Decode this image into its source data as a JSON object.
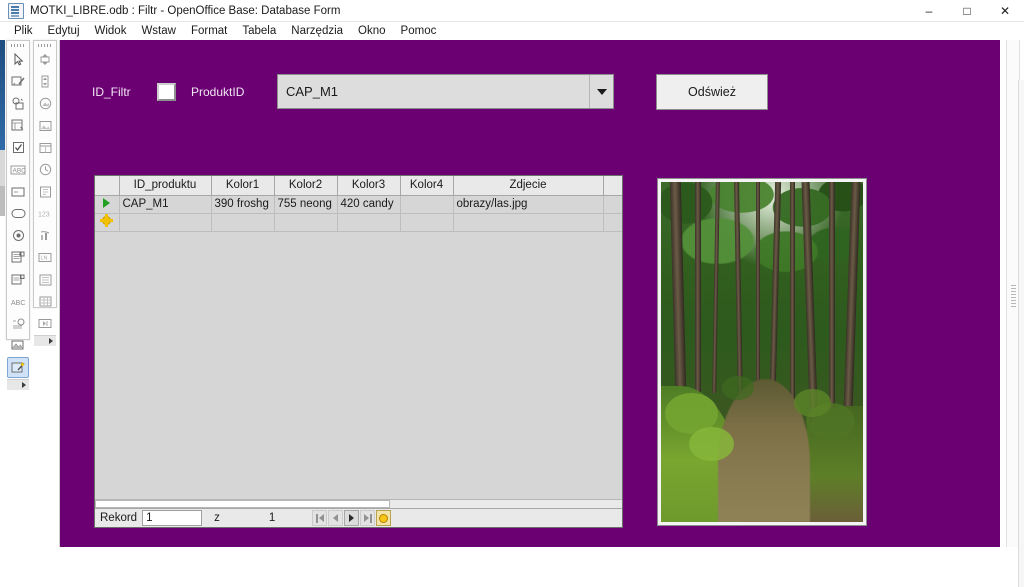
{
  "window": {
    "title": "MOTKI_LIBRE.odb : Filtr - OpenOffice Base: Database Form",
    "icon": "database-form-icon",
    "minimize_label": "–",
    "maximize_label": "□",
    "close_label": "✕"
  },
  "menubar": {
    "items": [
      {
        "label": "Plik"
      },
      {
        "label": "Edytuj"
      },
      {
        "label": "Widok"
      },
      {
        "label": "Wstaw"
      },
      {
        "label": "Format"
      },
      {
        "label": "Tabela"
      },
      {
        "label": "Narzędzia"
      },
      {
        "label": "Okno"
      },
      {
        "label": "Pomoc"
      }
    ]
  },
  "toolbars": {
    "form_controls": {
      "name": "Form Controls",
      "items": [
        {
          "icon": "select-arrow-icon",
          "selected": false
        },
        {
          "icon": "design-mode-icon",
          "selected": false
        },
        {
          "icon": "control-wizards-icon",
          "selected": false
        },
        {
          "icon": "form-properties-icon",
          "selected": false
        },
        {
          "icon": "check-box-icon",
          "selected": false
        },
        {
          "icon": "label-field-icon",
          "selected": false
        },
        {
          "icon": "text-box-icon",
          "selected": false
        },
        {
          "icon": "push-button-icon",
          "selected": false
        },
        {
          "icon": "option-button-icon",
          "selected": false
        },
        {
          "icon": "list-box-icon",
          "selected": false
        },
        {
          "icon": "combo-box-icon",
          "selected": false
        },
        {
          "icon": "formatted-field-icon",
          "selected": false
        },
        {
          "icon": "group-box-icon",
          "selected": false
        },
        {
          "icon": "image-control-icon",
          "selected": false
        },
        {
          "icon": "wizards-on-off-icon",
          "selected": true
        }
      ]
    },
    "more_controls": {
      "name": "More Controls",
      "items": [
        {
          "icon": "spin-button-icon"
        },
        {
          "icon": "scrollbar-icon"
        },
        {
          "icon": "image-button-icon"
        },
        {
          "icon": "file-selection-icon"
        },
        {
          "icon": "date-field-icon"
        },
        {
          "icon": "time-field-icon"
        },
        {
          "icon": "numeric-field-icon"
        },
        {
          "icon": "currency-field-icon"
        },
        {
          "icon": "pattern-field-icon"
        },
        {
          "icon": "table-control-icon"
        },
        {
          "icon": "list-control-icon"
        },
        {
          "icon": "grid-control-icon"
        },
        {
          "icon": "navigation-bar-icon"
        }
      ]
    }
  },
  "form": {
    "background_color": "#6b0072",
    "label_id_filtr": "ID_Filtr",
    "label_produkt_id": "ProduktID",
    "id_filtr_value": "",
    "combo_product": {
      "value": "CAP_M1",
      "dropdown_icon": "chevron-down-icon"
    },
    "refresh_button": "Odśwież"
  },
  "grid": {
    "columns": [
      "ID_produktu",
      "Kolor1",
      "Kolor2",
      "Kolor3",
      "Kolor4",
      "Zdjecie"
    ],
    "rows": [
      {
        "marker": "current-record-icon",
        "ID_produktu": "CAP_M1",
        "Kolor1": "390 froshg",
        "Kolor2": "755 neong",
        "Kolor3": "420 candy",
        "Kolor4": "",
        "Zdjecie": "obrazy/las.jpg"
      },
      {
        "marker": "new-record-icon",
        "ID_produktu": "",
        "Kolor1": "",
        "Kolor2": "",
        "Kolor3": "",
        "Kolor4": "",
        "Zdjecie": ""
      }
    ],
    "navigation": {
      "record_label": "Rekord",
      "current_record": "1",
      "of_label": "z",
      "total_records": "1",
      "first_icon": "first-record-icon",
      "prev_icon": "previous-record-icon",
      "next_icon": "next-record-icon",
      "last_icon": "last-record-icon",
      "new_icon": "new-record-icon"
    }
  },
  "image_control": {
    "name": "image-control",
    "content": "forest-path-photo",
    "source_value": "obrazy/las.jpg"
  }
}
